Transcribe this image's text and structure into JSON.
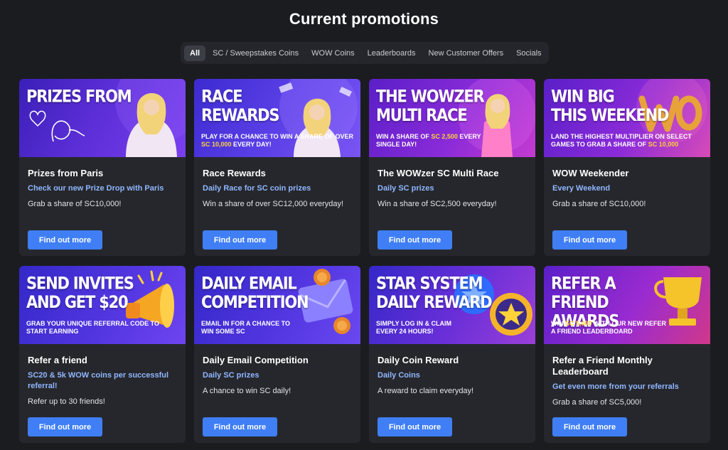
{
  "header": {
    "title": "Current promotions"
  },
  "filters": [
    "All",
    "SC / Sweepstakes Coins",
    "WOW Coins",
    "Leaderboards",
    "New Customer Offers",
    "Socials"
  ],
  "colors": {
    "background": "#1b1c20",
    "card": "#26272c",
    "accent": "#3f7ef5",
    "subtitle": "#8fb7ff",
    "highlight": "#ffd23a"
  },
  "cards": [
    {
      "banner_headline": "PRIZES FROM",
      "banner_sub_pre": "",
      "banner_sub_hl": "",
      "banner_sub_post": "",
      "banner_script": "Paris",
      "title": "Prizes from Paris",
      "subtitle": "Check our new Prize Drop with Paris",
      "description": "Grab a share of SC10,000!",
      "cta": "Find out more",
      "banner_icon": "paris-portrait"
    },
    {
      "banner_headline": "RACE\nREWARDS",
      "banner_sub_pre": "PLAY FOR A CHANCE TO WIN A SHARE OF OVER ",
      "banner_sub_hl": "SC 10,000",
      "banner_sub_post": " EVERY DAY!",
      "title": "Race Rewards",
      "subtitle": "Daily Race for SC coin prizes",
      "description": "Win a share of over SC12,000 everyday!",
      "cta": "Find out more",
      "banner_icon": "paris-portrait"
    },
    {
      "banner_headline": "THE WOWZER\nMULTI RACE",
      "banner_sub_pre": "WIN A SHARE OF ",
      "banner_sub_hl": "SC 2,500",
      "banner_sub_post": " EVERY SINGLE DAY!",
      "title": "The WOWzer SC Multi Race",
      "subtitle": "Daily SC prizes",
      "description": "Win a share of SC2,500 everyday!",
      "cta": "Find out more",
      "banner_icon": "paris-portrait"
    },
    {
      "banner_headline": "WIN BIG\nTHIS WEEKEND",
      "banner_sub_pre": "LAND THE HIGHEST MULTIPLIER ON SELECT GAMES TO GRAB A SHARE OF ",
      "banner_sub_hl": "SC 10,000",
      "banner_sub_post": "",
      "title": "WOW Weekender",
      "subtitle": "Every Weekend",
      "description": "Grab a share of SC10,000!",
      "cta": "Find out more",
      "banner_icon": "wow-logo"
    },
    {
      "banner_headline": "SEND INVITES\nAND GET $20",
      "banner_sub_pre": "GRAB YOUR UNIQUE REFERRAL CODE TO START EARNING",
      "banner_sub_hl": "",
      "banner_sub_post": "",
      "title": "Refer a friend",
      "subtitle": "SC20 & 5k WOW coins per successful referral!",
      "description": "Refer up to 30 friends!",
      "cta": "Find out more",
      "banner_icon": "megaphone-icon"
    },
    {
      "banner_headline": "DAILY EMAIL\nCOMPETITION",
      "banner_sub_pre": "EMAIL IN FOR A CHANCE TO WIN SOME SC",
      "banner_sub_hl": "",
      "banner_sub_post": "",
      "title": "Daily Email Competition",
      "subtitle": "Daily SC prizes",
      "description": "A chance to win SC daily!",
      "cta": "Find out more",
      "banner_icon": "envelope-icon"
    },
    {
      "banner_headline": "STAR SYSTEM\nDAILY REWARD",
      "banner_sub_pre": "SIMPLY LOG IN & CLAIM EVERY 24 HOURS!",
      "banner_sub_hl": "",
      "banner_sub_post": "",
      "title": "Daily Coin Reward",
      "subtitle": "Daily Coins",
      "description": "A reward to claim everyday!",
      "cta": "Find out more",
      "banner_icon": "star-icon"
    },
    {
      "banner_headline": "REFER A FRIEND\nAWARDS",
      "banner_sub_pre": "WIN ",
      "banner_sub_hl": "SC 5,000",
      "banner_sub_post": " WITH OUR NEW REFER A FRIEND LEADERBOARD",
      "title": "Refer a Friend Monthly Leaderboard",
      "subtitle": "Get even more from your referrals",
      "description": "Grab a share of SC5,000!",
      "cta": "Find out more",
      "banner_icon": "trophy-icon"
    }
  ]
}
